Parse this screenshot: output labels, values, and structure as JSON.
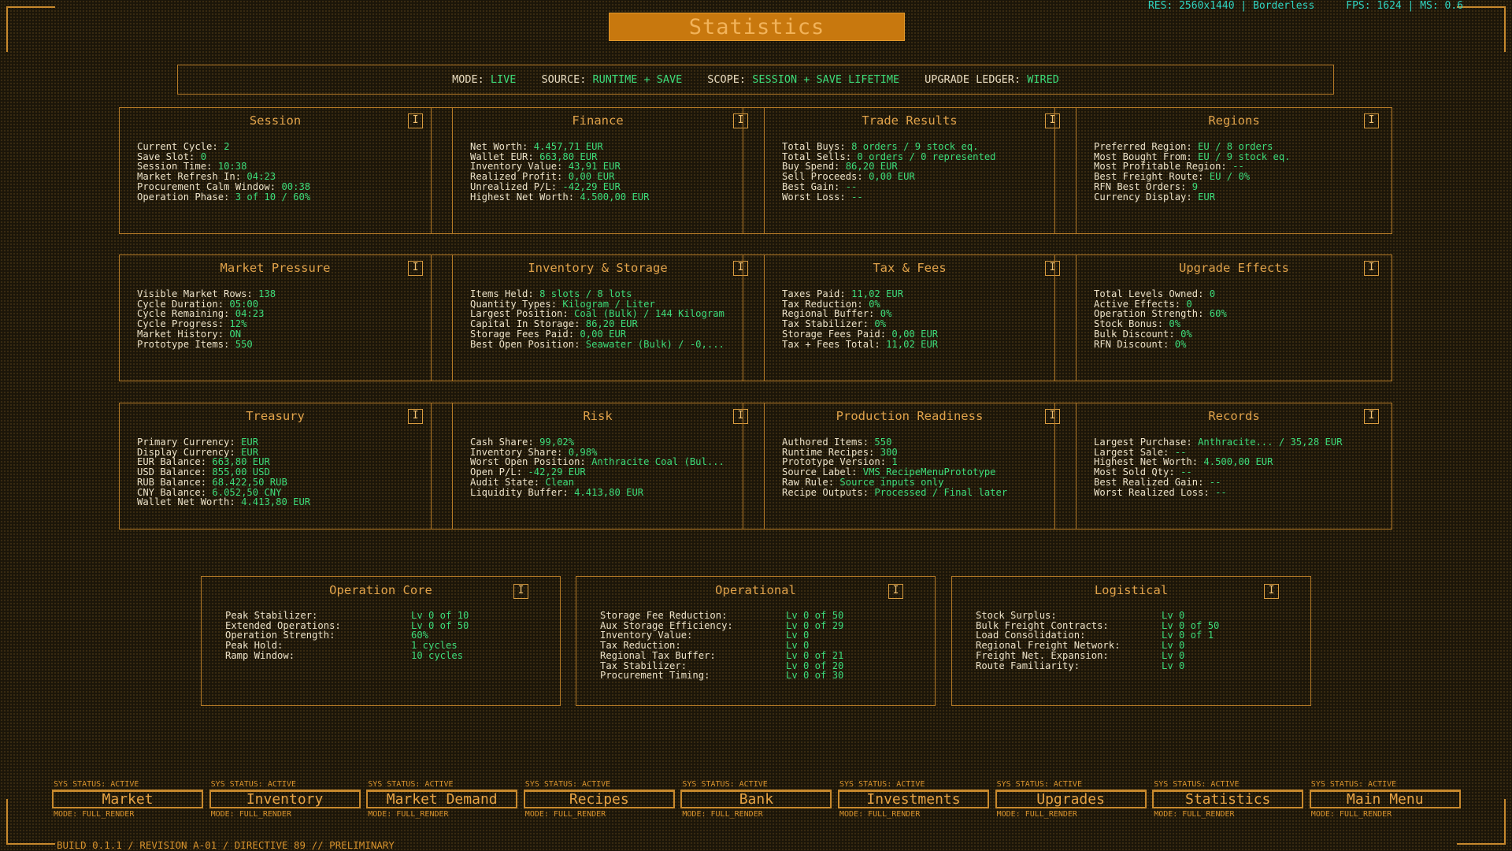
{
  "hud": {
    "res": "RES: 2560x1440 | Borderless",
    "fps": "FPS: 1624 | MS: 0.6"
  },
  "title": "Statistics",
  "modebar": [
    {
      "label": "MODE:",
      "value": "LIVE"
    },
    {
      "label": "SOURCE:",
      "value": "RUNTIME + SAVE"
    },
    {
      "label": "SCOPE:",
      "value": "SESSION + SAVE LIFETIME"
    },
    {
      "label": "UPGRADE LEDGER:",
      "value": "WIRED"
    }
  ],
  "info_icon": "I",
  "rows": [
    [
      {
        "title": "Session",
        "lines": [
          [
            "Current Cycle:",
            "2"
          ],
          [
            "Save Slot:",
            "0"
          ],
          [
            "Session Time:",
            "10:38"
          ],
          [
            "Market Refresh In:",
            "04:23"
          ],
          [
            "Procurement Calm Window:",
            "00:38"
          ],
          [
            "Operation Phase:",
            "3 of 10 / 60%"
          ]
        ]
      },
      {
        "title": "Finance",
        "lines": [
          [
            "Net Worth:",
            "4.457,71 EUR"
          ],
          [
            "Wallet EUR:",
            "663,80 EUR"
          ],
          [
            "Inventory Value:",
            "43,91 EUR"
          ],
          [
            "Realized Profit:",
            "0,00 EUR"
          ],
          [
            "Unrealized P/L:",
            "-42,29 EUR"
          ],
          [
            "Highest Net Worth:",
            "4.500,00 EUR"
          ]
        ]
      },
      {
        "title": "Trade Results",
        "lines": [
          [
            "Total Buys:",
            "8 orders / 9 stock eq."
          ],
          [
            "Total Sells:",
            "0 orders / 0 represented"
          ],
          [
            "Buy Spend:",
            "86,20 EUR"
          ],
          [
            "Sell Proceeds:",
            "0,00 EUR"
          ],
          [
            "Best Gain:",
            "--"
          ],
          [
            "Worst Loss:",
            "--"
          ]
        ]
      },
      {
        "title": "Regions",
        "lines": [
          [
            "Preferred Region:",
            "EU / 8 orders"
          ],
          [
            "Most Bought From:",
            "EU / 9 stock eq."
          ],
          [
            "Most Profitable Region:",
            "--"
          ],
          [
            "Best Freight Route:",
            "EU / 0%"
          ],
          [
            "RFN Best Orders:",
            "9"
          ],
          [
            "Currency Display:",
            "EUR"
          ]
        ]
      }
    ],
    [
      {
        "title": "Market Pressure",
        "lines": [
          [
            "Visible Market Rows:",
            "138"
          ],
          [
            "Cycle Duration:",
            "05:00"
          ],
          [
            "Cycle Remaining:",
            "04:23"
          ],
          [
            "Cycle Progress:",
            "12%"
          ],
          [
            "Market History:",
            "ON"
          ],
          [
            "Prototype Items:",
            "550"
          ]
        ]
      },
      {
        "title": "Inventory & Storage",
        "lines": [
          [
            "Items Held:",
            "8 slots / 8 lots"
          ],
          [
            "Quantity Types:",
            "Kilogram / Liter"
          ],
          [
            "Largest Position:",
            "Coal (Bulk) / 144 Kilogram"
          ],
          [
            "Capital In Storage:",
            "86,20 EUR"
          ],
          [
            "Storage Fees Paid:",
            "0,00 EUR"
          ],
          [
            "Best Open Position:",
            "Seawater (Bulk) / -0,..."
          ]
        ]
      },
      {
        "title": "Tax & Fees",
        "lines": [
          [
            "Taxes Paid:",
            "11,02 EUR"
          ],
          [
            "Tax Reduction:",
            "0%"
          ],
          [
            "Regional Buffer:",
            "0%"
          ],
          [
            "Tax Stabilizer:",
            "0%"
          ],
          [
            "Storage Fees Paid:",
            "0,00 EUR"
          ],
          [
            "Tax + Fees Total:",
            "11,02 EUR"
          ]
        ]
      },
      {
        "title": "Upgrade Effects",
        "lines": [
          [
            "Total Levels Owned:",
            "0"
          ],
          [
            "Active Effects:",
            "0"
          ],
          [
            "Operation Strength:",
            "60%"
          ],
          [
            "Stock Bonus:",
            "0%"
          ],
          [
            "Bulk Discount:",
            "0%"
          ],
          [
            "RFN Discount:",
            "0%"
          ]
        ]
      }
    ],
    [
      {
        "title": "Treasury",
        "lines": [
          [
            "Primary Currency:",
            "EUR"
          ],
          [
            "Display Currency:",
            "EUR"
          ],
          [
            "EUR Balance:",
            "663,80 EUR"
          ],
          [
            "USD Balance:",
            "855,00 USD"
          ],
          [
            "RUB Balance:",
            "68.422,50 RUB"
          ],
          [
            "CNY Balance:",
            "6.052,50 CNY"
          ],
          [
            "Wallet Net Worth:",
            "4.413,80 EUR"
          ]
        ]
      },
      {
        "title": "Risk",
        "lines": [
          [
            "Cash Share:",
            "99,02%"
          ],
          [
            "Inventory Share:",
            "0,98%"
          ],
          [
            "Worst Open Position:",
            "Anthracite Coal (Bul..."
          ],
          [
            "Open P/L:",
            "-42,29 EUR"
          ],
          [
            "Audit State:",
            "Clean"
          ],
          [
            "Liquidity Buffer:",
            "4.413,80 EUR"
          ]
        ]
      },
      {
        "title": "Production Readiness",
        "lines": [
          [
            "Authored Items:",
            "550"
          ],
          [
            "Runtime Recipes:",
            "300"
          ],
          [
            "Prototype Version:",
            "1"
          ],
          [
            "Source Label:",
            "VMS_RecipeMenuPrototype"
          ],
          [
            "Raw Rule:",
            "Source inputs only"
          ],
          [
            "Recipe Outputs:",
            "Processed / Final later"
          ]
        ]
      },
      {
        "title": "Records",
        "lines": [
          [
            "Largest Purchase:",
            "Anthracite... / 35,28 EUR"
          ],
          [
            "Largest Sale:",
            "--"
          ],
          [
            "Highest Net Worth:",
            "4.500,00 EUR"
          ],
          [
            "Most Sold Qty:",
            "--"
          ],
          [
            "Best Realized Gain:",
            "--"
          ],
          [
            "Worst Realized Loss:",
            "--"
          ]
        ]
      }
    ]
  ],
  "upgrades": [
    {
      "title": "Operation Core",
      "lines": [
        [
          "Peak Stabilizer:",
          "Lv 0 of 10"
        ],
        [
          "Extended Operations:",
          "Lv 0 of 50"
        ],
        [
          "Operation Strength:",
          "60%"
        ],
        [
          "Peak Hold:",
          "1 cycles"
        ],
        [
          "Ramp Window:",
          "10 cycles"
        ]
      ]
    },
    {
      "title": "Operational",
      "lines": [
        [
          "Storage Fee Reduction:",
          "Lv 0 of 50"
        ],
        [
          "Aux Storage Efficiency:",
          "Lv 0 of 29"
        ],
        [
          "Inventory Value:",
          "Lv 0"
        ],
        [
          "Tax Reduction:",
          "Lv 0"
        ],
        [
          "Regional Tax Buffer:",
          "Lv 0 of 21"
        ],
        [
          "Tax Stabilizer:",
          "Lv 0 of 20"
        ],
        [
          "Procurement Timing:",
          "Lv 0 of 30"
        ]
      ]
    },
    {
      "title": "Logistical",
      "lines": [
        [
          "Stock Surplus:",
          "Lv 0"
        ],
        [
          "Bulk Freight Contracts:",
          "Lv 0 of 50"
        ],
        [
          "Load Consolidation:",
          "Lv 0 of 1"
        ],
        [
          "Regional Freight Network:",
          "Lv 0"
        ],
        [
          "Freight Net. Expansion:",
          "Lv 0"
        ],
        [
          "Route Familiarity:",
          "Lv 0"
        ]
      ]
    }
  ],
  "nav": {
    "status": "SYS STATUS: ACTIVE",
    "mode": "MODE: FULL_RENDER",
    "buttons": [
      "Market",
      "Inventory",
      "Market Demand",
      "Recipes",
      "Bank",
      "Investments",
      "Upgrades",
      "Statistics",
      "Main Menu"
    ]
  },
  "footer": "BUILD 0.1.1 / REVISION A-01 / DIRECTIVE 89 // PRELIMINARY"
}
